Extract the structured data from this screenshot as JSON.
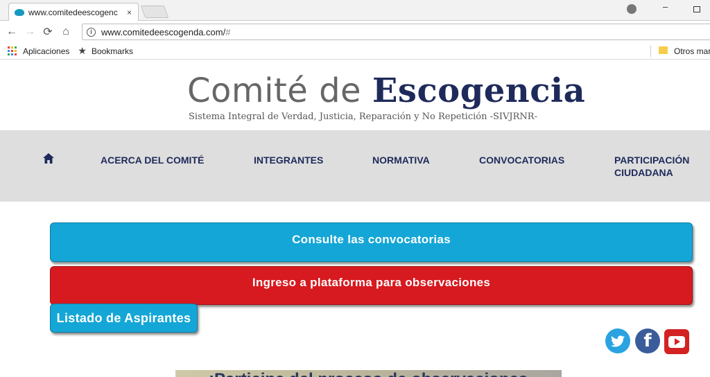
{
  "browser": {
    "tab_title": "www.comitedeescogenc",
    "tab_close": "×",
    "url_main": "www.comitedeescogenda.com/",
    "url_hash": "#",
    "bookmarks": {
      "apps": "Aplicaciones",
      "bookmarks": "Bookmarks",
      "other": "Otros mar"
    },
    "icons": {
      "back": "←",
      "forward": "→",
      "reload": "⟳",
      "home": "⌂",
      "info": "i",
      "minimize": "–"
    }
  },
  "site": {
    "logo_part1": "Comité de ",
    "logo_part2": "Escogencia",
    "logo_subtitle": "Sistema Integral de Verdad, Justicia, Reparación y No Repetición -SIVJRNR-",
    "nav": {
      "about": "ACERCA DEL COMITÉ",
      "members": "INTEGRANTES",
      "regulation": "NORMATIVA",
      "calls": "CONVOCATORIAS",
      "participation_1": "PARTICIPACIÓN",
      "participation_2": "CIUDADANA"
    },
    "buttons": {
      "consult": "Consulte las convocatorias",
      "platform": "Ingreso a plataforma para observaciones",
      "applicants": "Listado de Aspirantes"
    },
    "social": {
      "twitter": "t",
      "facebook": "f"
    },
    "banner_text": "¡Participe del proceso de observaciones"
  },
  "colors": {
    "navy": "#1e2a5a",
    "blue_button": "#14a6d6",
    "red_button": "#d61a1f",
    "nav_band": "#dedede"
  }
}
